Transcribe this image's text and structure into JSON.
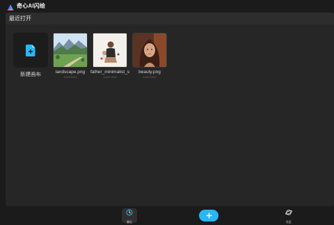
{
  "app": {
    "title": "奇心AI闪绘",
    "logo_icon": "app-logo-icon",
    "accent_color": "#29b6f6"
  },
  "recent": {
    "section_title": "最近打开",
    "new_canvas": {
      "label": "新建画布",
      "icon": "file-add-icon"
    },
    "items": [
      {
        "filename": "landscape.png",
        "meta": "1024*1024"
      },
      {
        "filename": "father_minimalist_s...",
        "meta": "1024*1024"
      },
      {
        "filename": "beauty.png",
        "meta": "1024*1024"
      }
    ]
  },
  "bottom_nav": {
    "recent_label": "最近",
    "recent_icon": "clock-icon",
    "add_icon": "plus-icon",
    "community_label": "社区",
    "community_icon": "planet-icon"
  }
}
